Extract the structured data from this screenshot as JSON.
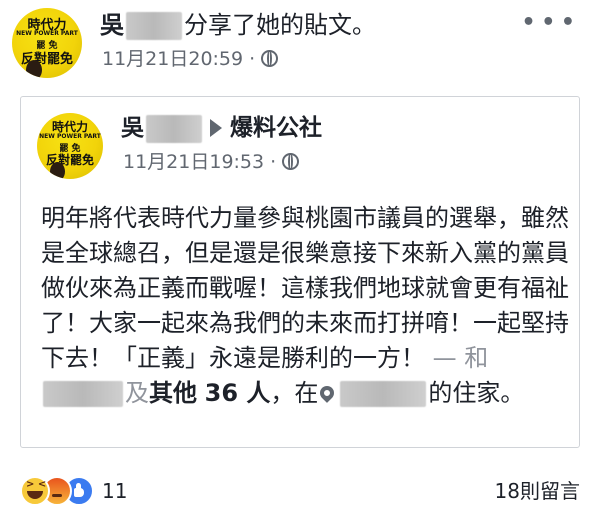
{
  "outer_post": {
    "author_name": "吳",
    "shared_text": "分享了她的貼文。",
    "timestamp": "11月21日20:59",
    "separator": "·",
    "audience_icon": "globe-icon",
    "more_icon": "more-options-icon",
    "more_label": "• • •"
  },
  "avatar": {
    "line1": "時代力",
    "line2": "NEW POWER PART",
    "line3": "罷 免",
    "line4": "反對罷免"
  },
  "shared_post": {
    "author_name": "吳",
    "arrow_icon": "arrow-right-icon",
    "group_name": "爆料公社",
    "timestamp": "11月21日19:53",
    "separator": "·",
    "audience_icon": "globe-icon",
    "body": "明年將代表時代力量參與桃園市議員的選舉，雖然是全球總召，但是還是很樂意接下來新入黨的黨員做伙來為正義而戰喔！這樣我們地球就會更有福祉了！大家一起來為我們的未來而打拼唷！一起堅持下去！「正義」永遠是勝利的一方！",
    "with_dash": "— 和",
    "with_and": "及",
    "with_others": "其他",
    "with_count": "36 人",
    "at_text": "，在",
    "location_icon": "map-pin-icon",
    "location_suffix": "的住家。"
  },
  "footer": {
    "reaction_icons": [
      "haha-icon",
      "angry-icon",
      "like-icon"
    ],
    "reaction_count": "11",
    "comments": "18則留言"
  }
}
